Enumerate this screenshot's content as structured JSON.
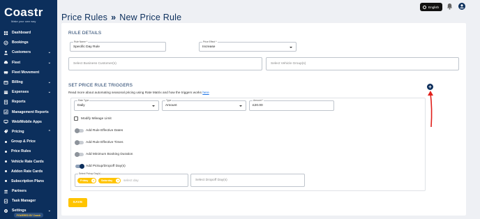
{
  "brand": {
    "name": "Coastr",
    "tagline": "Make your own way",
    "powered_by": "POWERED BY Coastr"
  },
  "sidebar": {
    "items": [
      {
        "label": "Dashboard",
        "icon": "dashboard-icon",
        "expandable": false
      },
      {
        "label": "Bookings",
        "icon": "bookings-icon",
        "expandable": false
      },
      {
        "label": "Customers",
        "icon": "customers-icon",
        "expandable": true
      },
      {
        "label": "Fleet",
        "icon": "car-icon",
        "expandable": true
      },
      {
        "label": "Fleet Movement",
        "icon": "fleet-movement-icon",
        "expandable": false
      },
      {
        "label": "Billing",
        "icon": "billing-icon",
        "expandable": true
      },
      {
        "label": "Expenses",
        "icon": "expenses-icon",
        "expandable": true
      },
      {
        "label": "Reports",
        "icon": "reports-icon",
        "expandable": false
      },
      {
        "label": "Management Reports",
        "icon": "management-reports-icon",
        "expandable": false
      },
      {
        "label": "Web/Mobile Apps",
        "icon": "apps-icon",
        "expandable": false
      },
      {
        "label": "Pricing",
        "icon": "pricing-icon",
        "expandable": true,
        "expanded": true
      },
      {
        "label": "Group & Price",
        "sub": true
      },
      {
        "label": "Price Rules",
        "sub": true,
        "active": true
      },
      {
        "label": "Vehicle Rate Cards",
        "sub": true
      },
      {
        "label": "Addon Rate Cards",
        "sub": true
      },
      {
        "label": "Subscription Plans",
        "sub": true
      },
      {
        "label": "Partners",
        "icon": "partners-icon",
        "expandable": false
      },
      {
        "label": "Task Manager",
        "icon": "task-manager-icon",
        "expandable": false
      },
      {
        "label": "Settings",
        "icon": "settings-icon",
        "expandable": true
      }
    ]
  },
  "header": {
    "breadcrumb_parent": "Price Rules",
    "breadcrumb_sep": "»",
    "breadcrumb_current": "New Price Rule",
    "language": "English"
  },
  "rule_details": {
    "title": "RULE DETAILS",
    "rule_name": {
      "label": "Rule Name *",
      "value": "Specific Day Rule"
    },
    "price_effect": {
      "label": "Price Effect *",
      "value": "Increase"
    },
    "business_customers": {
      "placeholder": "Select Business Customer(s)"
    },
    "vehicle_groups": {
      "placeholder": "Select Vehicle Group(s)"
    }
  },
  "triggers": {
    "title": "SET PRICE RULE TRIGGERS",
    "help_text": "Read more about automating seasonal pricing using Rate Matrix and how the triggers works",
    "help_link": "here",
    "rate_type": {
      "label": "Rate Type",
      "value": "Daily"
    },
    "type": {
      "label": "Type",
      "value": "Amount"
    },
    "amount": {
      "label": "Amount *",
      "value": "£20.00"
    },
    "modify_mileage": "Modify Mileage Limit",
    "options": [
      {
        "label": "Add Rule Effective Dates",
        "on": false
      },
      {
        "label": "Add Rule Effective Times",
        "on": false
      },
      {
        "label": "Add Minimum Booking Duration",
        "on": false
      },
      {
        "label": "Add Pickup/Dropoff Day(s)",
        "on": true
      }
    ],
    "pickup_days": {
      "label": "Select Pickup Day(s)",
      "chips": [
        "Friday",
        "Saturday"
      ],
      "placeholder": "select day"
    },
    "dropoff_days": {
      "placeholder": "Select Dropoff Day(s)"
    }
  },
  "actions": {
    "save": "SAVE"
  },
  "colors": {
    "navy": "#0c2f5c",
    "accent": "#ffc400",
    "annotation": "#e0201b"
  }
}
